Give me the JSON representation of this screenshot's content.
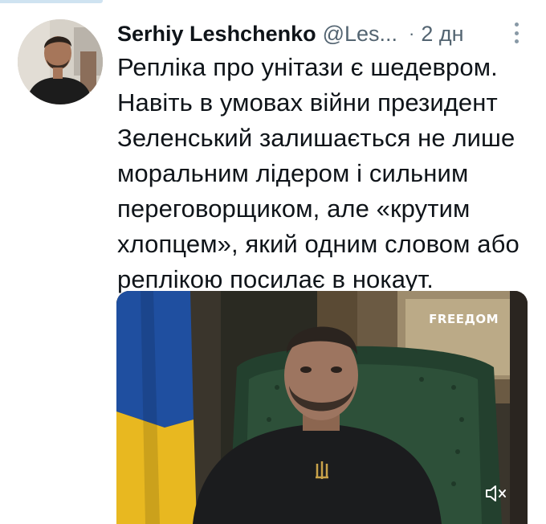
{
  "tweet": {
    "author_name": "Serhiy Leshchenko",
    "author_handle": "@Les...",
    "separator": "·",
    "timestamp": "2 дн",
    "text": "Репліка про унітази є шедевром.\nНавіть в умовах війни президент\nЗеленський залишається не лише\nморальним лідером і сильним\nпереговорщиком, але «крутим\nхлопцем», який одним словом або\nреплікою посилає в нокаут."
  },
  "media": {
    "brand_label": "FREEДOM",
    "mute_icon": "speaker-muted-icon"
  },
  "icons": {
    "more": "more-vertical-icon",
    "avatar": "avatar"
  },
  "colors": {
    "text": "#0f1419",
    "secondary": "#536471",
    "flag_blue": "#1f4fa0",
    "flag_yellow": "#e8b820"
  }
}
